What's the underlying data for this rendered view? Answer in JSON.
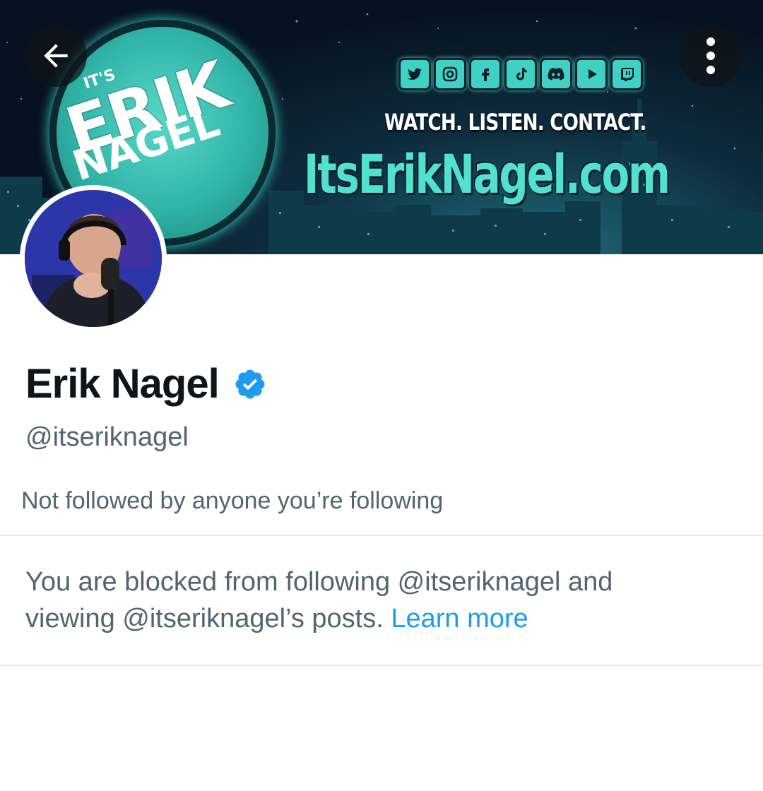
{
  "banner": {
    "logo_its": "IT'S",
    "logo_erik": "ERIK",
    "logo_nagel": "NAGEL",
    "tagline": "WATCH. LISTEN. CONTACT.",
    "site": "ItsErikNagel.com",
    "social_icons": [
      "twitter-icon",
      "instagram-icon",
      "facebook-icon",
      "tiktok-icon",
      "discord-icon",
      "youtube-icon",
      "twitch-icon"
    ],
    "accent_color": "#3fd1c3"
  },
  "nav": {
    "back_icon": "arrow-left-icon",
    "more_icon": "more-vertical-icon"
  },
  "profile": {
    "name": "Erik Nagel",
    "handle": "@itseriknagel",
    "verified": true,
    "verified_color": "#1d9bf0",
    "followed_by_text": "Not followed by anyone you’re following"
  },
  "blocked_notice": {
    "text": "You are blocked from following @itseriknagel and viewing @itseriknagel’s posts.",
    "link_label": "Learn more",
    "link_color": "#1d9bf0"
  }
}
